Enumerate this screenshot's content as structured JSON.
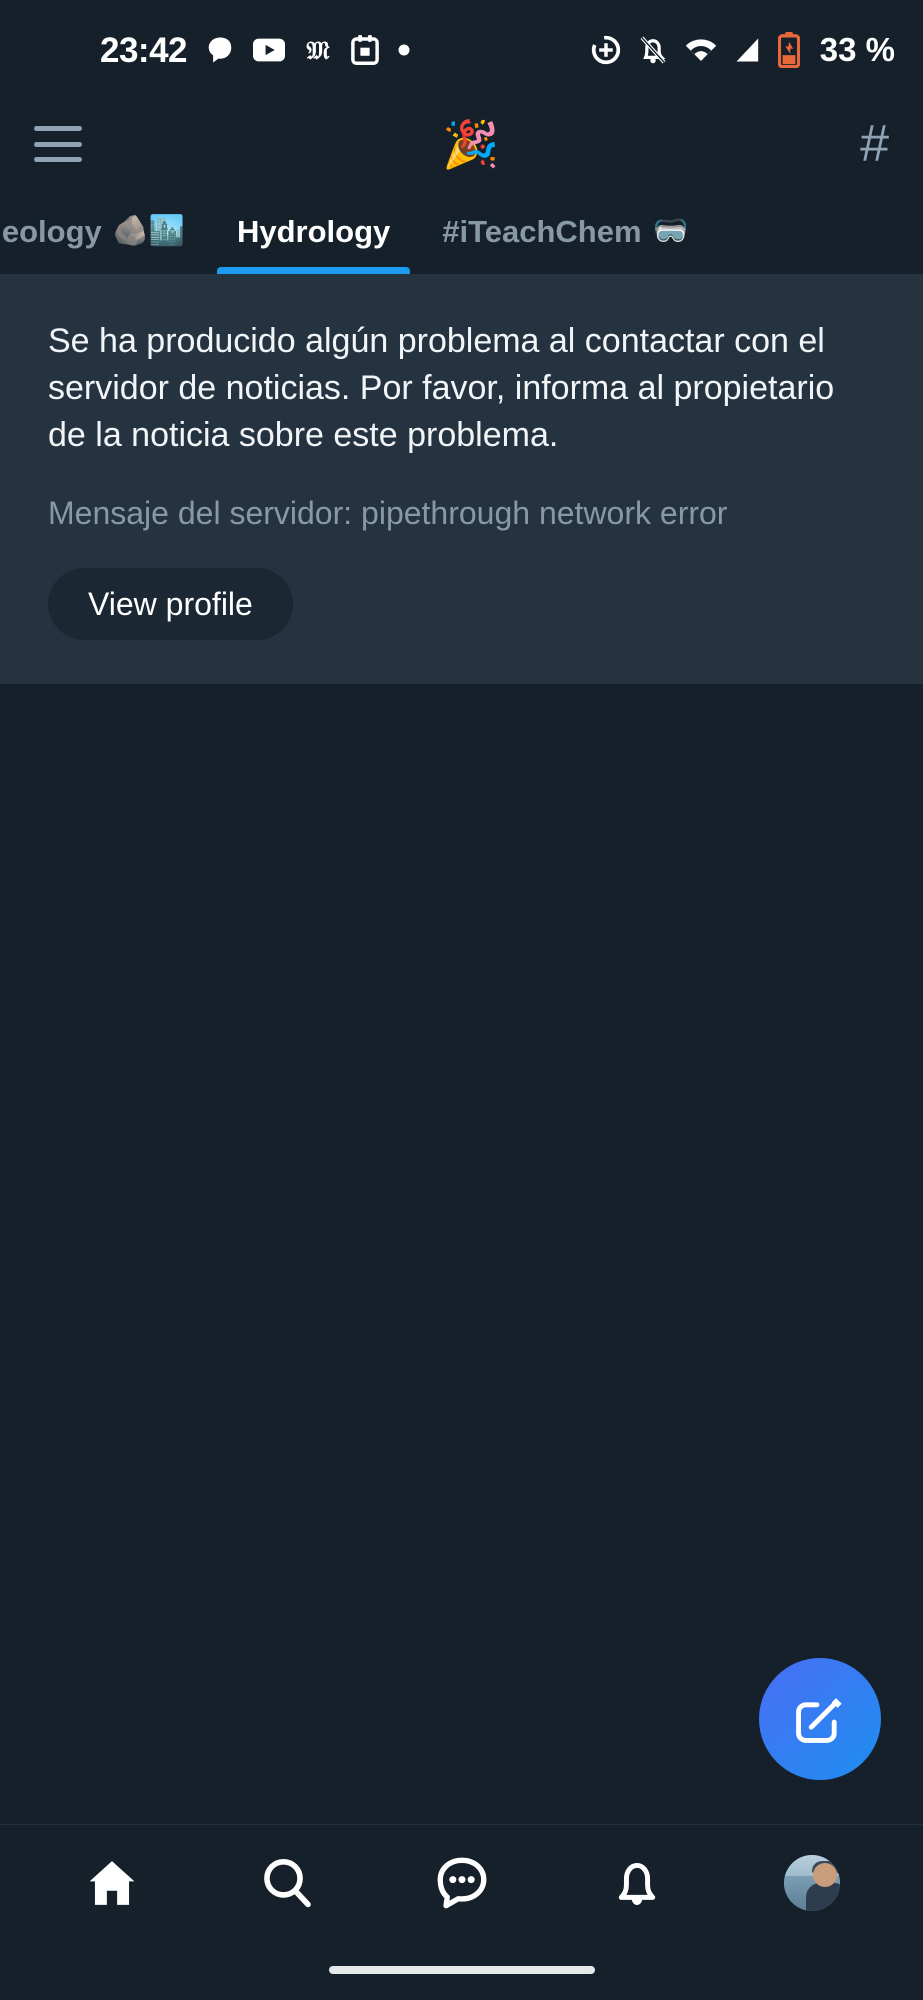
{
  "status_bar": {
    "time": "23:42",
    "battery_percent": "33 %",
    "left_icons": [
      "chat-bubble-icon",
      "youtube-icon",
      "gothic-m-icon",
      "calendar-icon",
      "dot-icon"
    ],
    "right_icons": [
      "location-add-icon",
      "notifications-off-icon",
      "wifi-icon",
      "cellular-signal-icon",
      "battery-low-icon"
    ],
    "battery_color": "#e8683c",
    "text_color": "#ffffff"
  },
  "header": {
    "menu_icon": "hamburger-menu-icon",
    "logo_emoji": "🎉",
    "logo_name": "party-popper-logo",
    "hashtag_label": "#",
    "icon_color": "#8fa3b5"
  },
  "tabs": {
    "accent_color": "#1d9bf0",
    "items": [
      {
        "label": "ban Geology",
        "emoji": "🪨🏙️",
        "active": false,
        "name": "tab-urban-geology"
      },
      {
        "label": "Hydrology",
        "emoji": "",
        "active": true,
        "name": "tab-hydrology"
      },
      {
        "label": "#iTeachChem",
        "emoji": "🥽",
        "active": false,
        "name": "tab-iteachchem"
      }
    ]
  },
  "error_card": {
    "background": "#253341",
    "message": "Se ha producido algún problema al contactar con el servidor de noticias. Por favor, informa al propietario de la noticia sobre este problema.",
    "server_message": "Mensaje del servidor: pipethrough network error",
    "button_label": "View profile"
  },
  "fab": {
    "name": "compose-fab",
    "icon": "compose-edit-icon",
    "color": "#1d8ef0"
  },
  "bottom_nav": {
    "items": [
      {
        "name": "nav-home",
        "icon": "home-icon",
        "active": true
      },
      {
        "name": "nav-search",
        "icon": "search-icon",
        "active": false
      },
      {
        "name": "nav-messages",
        "icon": "chat-bubble-dots-icon",
        "active": false
      },
      {
        "name": "nav-notifications",
        "icon": "bell-icon",
        "active": false
      },
      {
        "name": "nav-profile",
        "icon": "avatar",
        "active": false
      }
    ]
  },
  "system": {
    "home_indicator": "home-indicator"
  }
}
